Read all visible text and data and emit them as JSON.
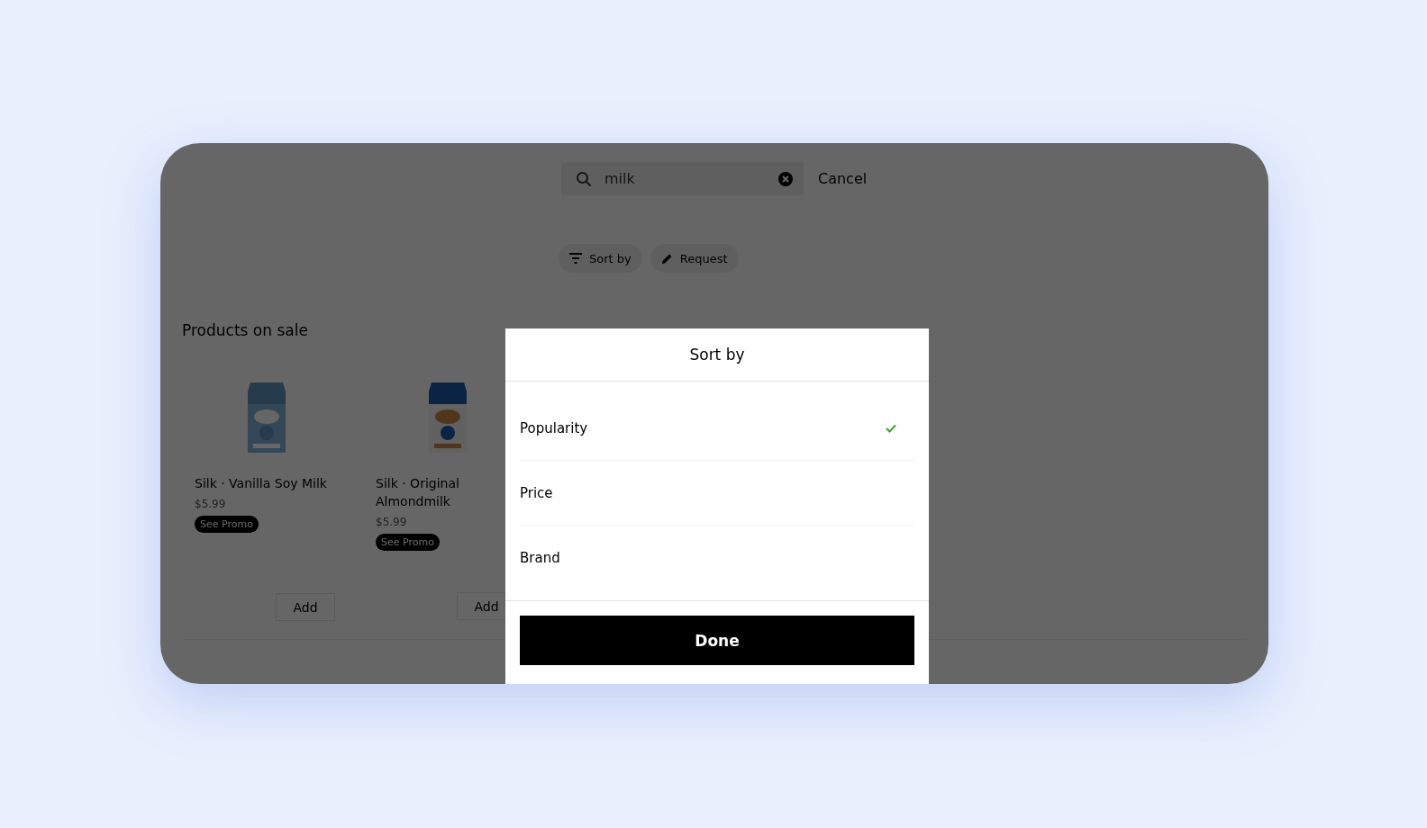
{
  "search": {
    "value": "milk",
    "cancel": "Cancel"
  },
  "chips": [
    {
      "kind": "sort",
      "label": "Sort by"
    },
    {
      "kind": "request",
      "label": "Request"
    }
  ],
  "section_title": "Products on sale",
  "products": [
    {
      "name": "Silk · Vanilla Soy Milk",
      "price": "$5.99",
      "promo": "See Promo",
      "add": "Add"
    },
    {
      "name": "Silk · Original Almondmilk",
      "price": "$5.99",
      "promo": "See Promo",
      "add": "Add"
    }
  ],
  "modal": {
    "title": "Sort by",
    "options": [
      {
        "label": "Popularity",
        "selected": true
      },
      {
        "label": "Price",
        "selected": false
      },
      {
        "label": "Brand",
        "selected": false
      }
    ],
    "done": "Done"
  }
}
